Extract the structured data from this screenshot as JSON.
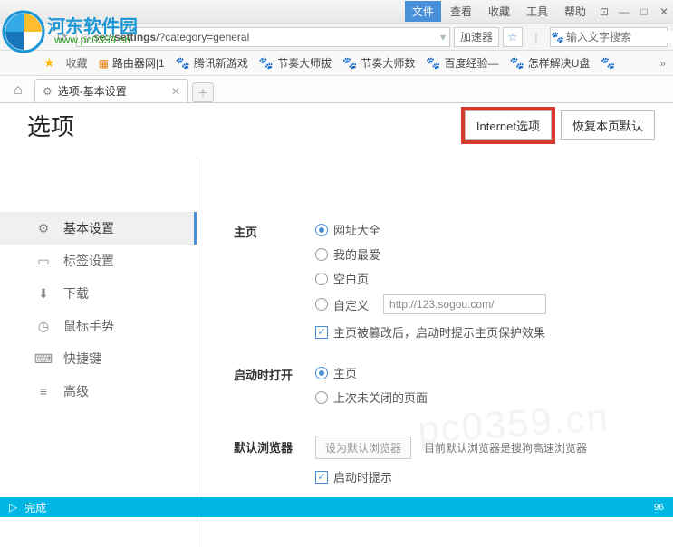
{
  "titlebar": {
    "brand": "河东软件园",
    "brand_url": "www.pc0359.cn",
    "menu": [
      "文件",
      "查看",
      "收藏",
      "工具",
      "帮助"
    ],
    "active_menu_index": 0
  },
  "addressbar": {
    "url_prefix": "se://",
    "url_bold": "settings",
    "url_rest": "/?category=general",
    "accelerator": "加速器",
    "search_placeholder": "输入文字搜索"
  },
  "bookmarks": {
    "fav_label": "收藏",
    "items": [
      "路由器网|1",
      "腾讯新游戏",
      "节奏大师拔",
      "节奏大师数",
      "百度经验—",
      "怎样解决U盘"
    ]
  },
  "tab": {
    "title": "选项-基本设置"
  },
  "page": {
    "title": "选项",
    "btn_internet": "Internet选项",
    "btn_restore": "恢复本页默认"
  },
  "sidebar": {
    "items": [
      {
        "label": "基本设置"
      },
      {
        "label": "标签设置"
      },
      {
        "label": "下载"
      },
      {
        "label": "鼠标手势"
      },
      {
        "label": "快捷键"
      },
      {
        "label": "高级"
      }
    ]
  },
  "settings": {
    "homepage": {
      "label": "主页",
      "opt1": "网址大全",
      "opt2": "我的最爱",
      "opt3": "空白页",
      "opt4": "自定义",
      "custom_url": "http://123.sogou.com/",
      "protect": "主页被篡改后，启动时提示主页保护效果"
    },
    "startup": {
      "label": "启动时打开",
      "opt1": "主页",
      "opt2": "上次未关闭的页面"
    },
    "default_browser": {
      "label": "默认浏览器",
      "btn": "设为默认浏览器",
      "desc": "目前默认浏览器是搜狗高速浏览器",
      "check": "启动时提示"
    }
  },
  "status": {
    "text": "完成",
    "pct": "96"
  },
  "watermark": "pc0359.cn"
}
